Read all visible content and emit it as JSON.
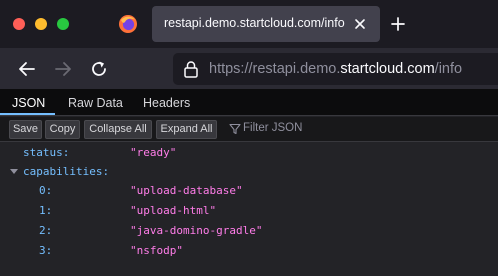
{
  "browser": {
    "tab_title": "restapi.demo.startcloud.com/info",
    "url_prefix": "https://restapi.demo.",
    "url_domain": "startcloud.com",
    "url_path": "/info"
  },
  "viewer": {
    "tabs": [
      "JSON",
      "Raw Data",
      "Headers"
    ],
    "active_tab": "JSON",
    "toolbar": {
      "save_label": "Save",
      "copy_label": "Copy",
      "collapse_label": "Collapse All",
      "expand_label": "Expand All",
      "filter_placeholder": "Filter JSON"
    }
  },
  "json": {
    "status": {
      "key": "status:",
      "value": "\"ready\""
    },
    "capabilities": {
      "key": "capabilities:",
      "items": [
        {
          "key": "0:",
          "value": "\"upload-database\""
        },
        {
          "key": "1:",
          "value": "\"upload-html\""
        },
        {
          "key": "2:",
          "value": "\"java-domino-gradle\""
        },
        {
          "key": "3:",
          "value": "\"nsfodp\""
        }
      ]
    }
  },
  "colors": {
    "key": "#75bfff",
    "string_value": "#ff7de9",
    "accent": "#75bfff"
  },
  "icons": [
    "close-window",
    "minimize-window",
    "maximize-window",
    "firefox-logo",
    "tab-close-icon",
    "new-tab-icon",
    "back-arrow-icon",
    "forward-arrow-icon",
    "reload-icon",
    "lock-icon",
    "filter-icon",
    "expand-twisty-icon"
  ]
}
